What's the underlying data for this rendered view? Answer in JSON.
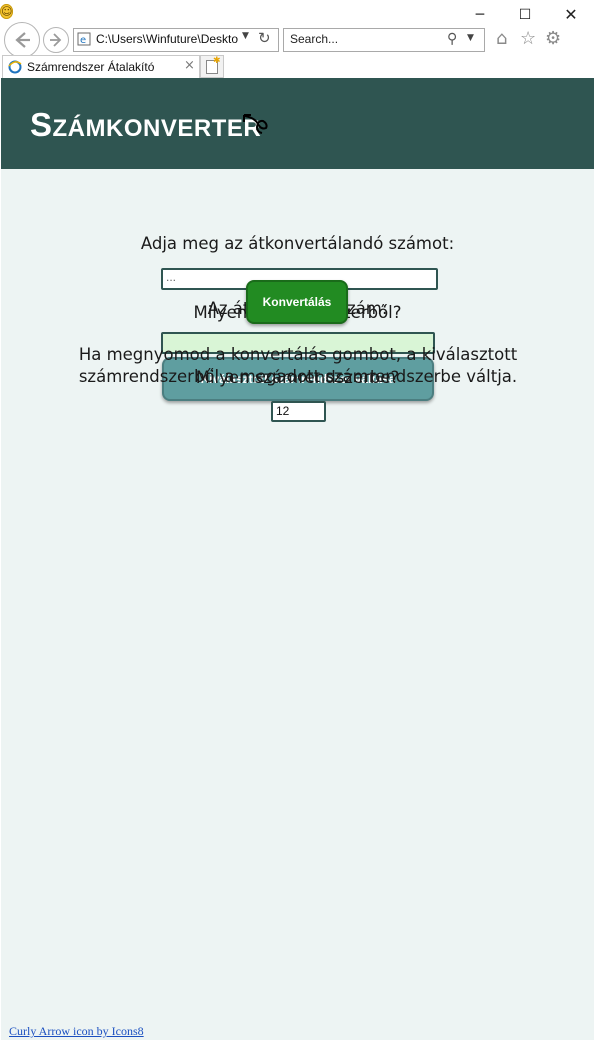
{
  "browser": {
    "address": "C:\\Users\\Winfuture\\Desktop",
    "search_placeholder": "Search...",
    "tab_title": "Számrendszer Átalakító",
    "tab_close": "×",
    "window_controls": {
      "minimize": "─",
      "maximize": "☐",
      "close": "✕"
    },
    "icons": [
      "back-arrow-icon",
      "forward-arrow-icon",
      "ie-icon",
      "dropdown-icon",
      "refresh-icon",
      "search-icon",
      "home-icon",
      "star-icon",
      "gear-icon",
      "smiley-icon",
      "new-tab-icon"
    ]
  },
  "header": {
    "brand_first": "S",
    "brand_rest": "ZÁMKONVERTER",
    "accent_color": "#2f5551",
    "icon": "curly-arrow-icon"
  },
  "form": {
    "question_number": "Adja meg az átkonvertálandó számot:",
    "number_placeholder": "...",
    "question_source_base": "Milyen számrendszerből?",
    "result_label": "Az átkonvertált szám:",
    "convert_button": "Konvertálás",
    "reset_button": "Kiválasztott számrendszer váltása",
    "info_text": "Ha megnyomod a konvertálás gombot, a kiválasztott számrendszerből a megadott számrendszerbe váltja.",
    "question_target_base": "Milyen számrendszerbe?",
    "target_base_value": "12"
  },
  "footer": {
    "credit": "Curly Arrow icon by Icons8"
  }
}
